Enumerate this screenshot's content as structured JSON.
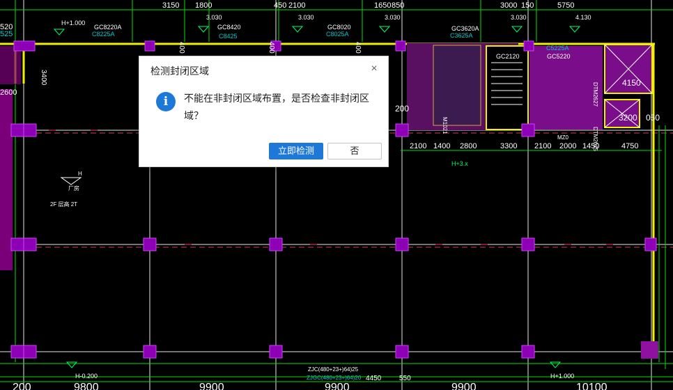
{
  "dialog": {
    "title": "检测封闭区域",
    "close_symbol": "×",
    "icon": "info-icon",
    "icon_glyph": "i",
    "message": "不能在非封闭区域布置，是否检查非封闭区域？",
    "confirm_label": "立即检测",
    "cancel_label": "否"
  },
  "drawing": {
    "top_dims": [
      "3150",
      "1800",
      "450",
      "2100",
      "1650",
      "850",
      "3000",
      "150",
      "5750"
    ],
    "vertical_dims": [
      "400 600",
      "400 600",
      "400 600",
      "3400"
    ],
    "left_labels": [
      "520",
      "525",
      "2600"
    ],
    "elevations": [
      "H+1.000",
      "3.030",
      "3.030",
      "3.030",
      "3.030",
      "4.130",
      "H+1.000",
      "H-0.200",
      "H+3.x"
    ],
    "window_codes": [
      "GC8220A",
      "C8225A",
      "GC8420",
      "C8425",
      "GC8020",
      "C8025A",
      "GC3620A",
      "C3625A",
      "GC2120",
      "GC5220",
      "C5225A"
    ],
    "door_codes": [
      "DTM2627",
      "DTM2625",
      "M1021",
      "MZ0"
    ],
    "room_labels": [
      "4150",
      "3200",
      "050",
      "200"
    ],
    "mid_dims": [
      "2100",
      "1400",
      "2800",
      "3300",
      "2100",
      "2000",
      "1450",
      "4750"
    ],
    "left_notes": [
      "H",
      "厂房",
      "2F 层高 2T"
    ],
    "beam_labels": [
      "ZJC(480+23+)64)25",
      "ZJGC(480+23+)64)20"
    ],
    "beam_dims": [
      "4450",
      "550"
    ],
    "bottom_dims": [
      "200",
      "9800",
      "9900",
      "9900",
      "9900",
      "10100"
    ],
    "colors": {
      "background": "#000000",
      "grid": "#ffffff",
      "wall": "#ffff00",
      "column": "#8000b0",
      "dim": "#00ff00",
      "accent": "#1e78d7"
    }
  }
}
